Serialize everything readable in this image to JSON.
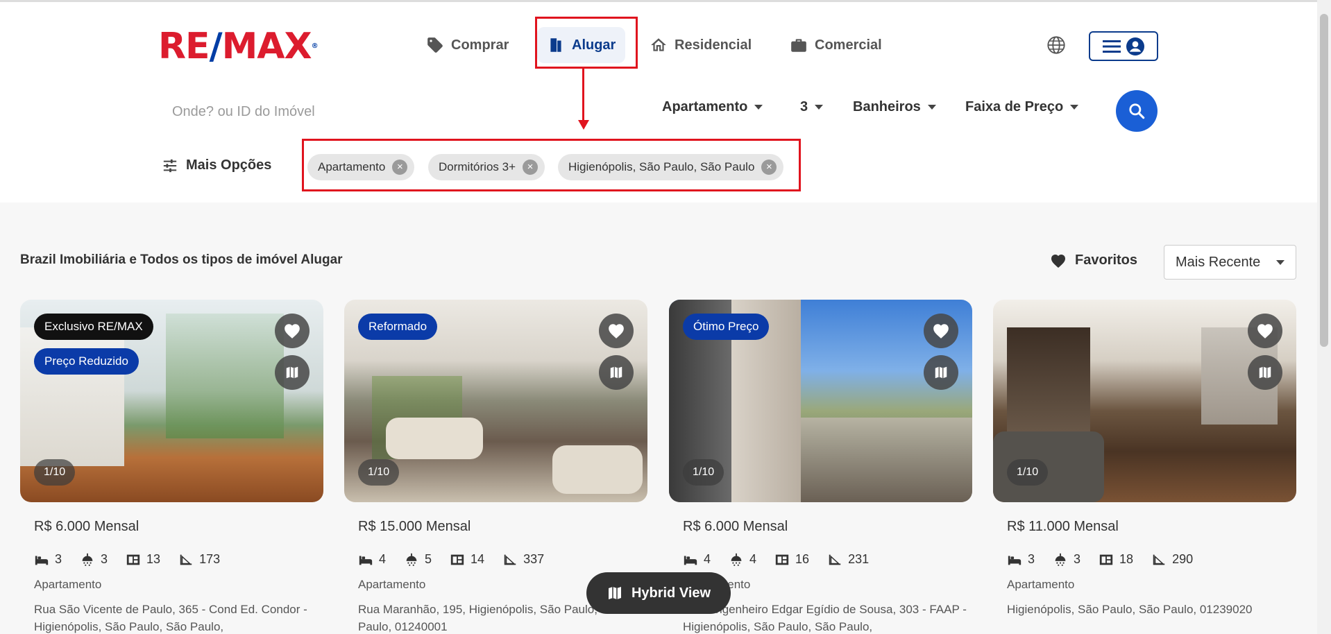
{
  "header": {
    "logo": "RE/MAX",
    "nav": [
      {
        "label": "Comprar",
        "icon": "tag-icon",
        "active": false
      },
      {
        "label": "Alugar",
        "icon": "door-icon",
        "active": true
      },
      {
        "label": "Residencial",
        "icon": "house-icon",
        "active": false
      },
      {
        "label": "Comercial",
        "icon": "briefcase-icon",
        "active": false
      }
    ],
    "language_icon": "globe-icon",
    "menu_icons": [
      "hamburger-icon",
      "user-icon"
    ]
  },
  "search": {
    "placeholder": "Onde? ou ID do Imóvel",
    "filters": {
      "type": "Apartamento",
      "bedrooms": "3",
      "bathrooms": "Banheiros",
      "price": "Faixa de Preço"
    },
    "more_options": "Mais Opções",
    "chips": [
      "Apartamento",
      "Dormitórios 3+",
      "Higienópolis, São Paulo, São Paulo"
    ]
  },
  "results": {
    "title": "Brazil Imobiliária e Todos os tipos de imóvel Alugar",
    "favorites_label": "Favoritos",
    "sort_label": "Mais Recente",
    "hybrid_label": "Hybrid View"
  },
  "listings": [
    {
      "badges": [
        "Exclusivo RE/MAX",
        "Preço Reduzido"
      ],
      "counter": "1/10",
      "price": "R$ 6.000 Mensal",
      "beds": "3",
      "baths": "3",
      "rooms": "13",
      "area": "173",
      "type": "Apartamento",
      "address": "Rua São Vicente de Paulo, 365 - Cond Ed. Condor - Higienópolis, São Paulo, São Paulo,"
    },
    {
      "badges": [
        "Reformado"
      ],
      "counter": "1/10",
      "price": "R$ 15.000 Mensal",
      "beds": "4",
      "baths": "5",
      "rooms": "14",
      "area": "337",
      "type": "Apartamento",
      "address": "Rua Maranhão, 195, Higienópolis, São Paulo, São Paulo, 01240001"
    },
    {
      "badges": [
        "Ótimo Preço"
      ],
      "counter": "1/10",
      "price": "R$ 6.000 Mensal",
      "beds": "4",
      "baths": "4",
      "rooms": "16",
      "area": "231",
      "type": "Apartamento",
      "address": "Rua Engenheiro Edgar Egídio de Sousa, 303 - FAAP - Higienópolis, São Paulo, São Paulo,"
    },
    {
      "badges": [],
      "counter": "1/10",
      "price": "R$ 11.000 Mensal",
      "beds": "3",
      "baths": "3",
      "rooms": "18",
      "area": "290",
      "type": "Apartamento",
      "address": "Higienópolis, São Paulo, São Paulo, 01239020"
    }
  ],
  "colors": {
    "brand_red": "#dc1c2e",
    "brand_blue": "#0b3b8c",
    "search_blue": "#1a5fd6",
    "annotation_red": "#e0141e"
  }
}
